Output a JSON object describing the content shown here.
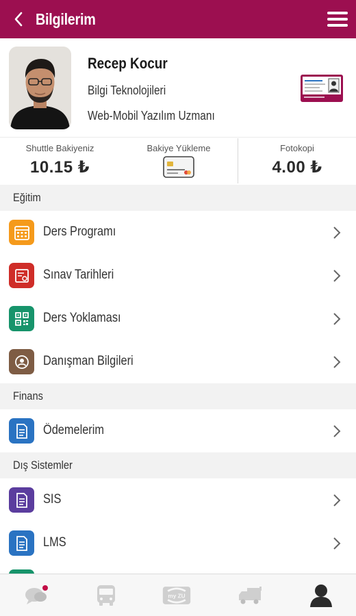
{
  "header": {
    "title": "Bilgilerim",
    "back_icon": "chevron-left-icon",
    "menu_icon": "hamburger-menu-icon",
    "background_color": "#9c0f50"
  },
  "profile": {
    "name": "Recep Kocur",
    "department": "Bilgi Teknolojileri",
    "role": "Web-Mobil Yazılım Uzmanı"
  },
  "balances": {
    "shuttle": {
      "label": "Shuttle Bakiyeniz",
      "value": "10.15 ₺"
    },
    "topup": {
      "label": "Bakiye Yükleme",
      "icon": "credit-card-icon"
    },
    "photocopy": {
      "label": "Fotokopi",
      "value": "4.00 ₺"
    }
  },
  "sections": {
    "education": {
      "title": "Eğitim",
      "items": [
        {
          "label": "Ders Programı",
          "icon": "calendar-icon",
          "color": "#f59a1b"
        },
        {
          "label": "Sınav Tarihleri",
          "icon": "exam-icon",
          "color": "#cf2d28"
        },
        {
          "label": "Ders Yoklaması",
          "icon": "qr-code-icon",
          "color": "#17946b"
        },
        {
          "label": "Danışman Bilgileri",
          "icon": "advisor-icon",
          "color": "#7e5c44"
        }
      ]
    },
    "finance": {
      "title": "Finans",
      "items": [
        {
          "label": "Ödemelerim",
          "icon": "document-icon",
          "color": "#2a73c2"
        }
      ]
    },
    "external": {
      "title": "Dış Sistemler",
      "items": [
        {
          "label": "SIS",
          "icon": "document-icon",
          "color": "#5b3d9e"
        },
        {
          "label": "LMS",
          "icon": "document-icon",
          "color": "#2a73c2"
        }
      ]
    }
  },
  "tabbar": {
    "tabs": [
      {
        "icon": "chat-icon",
        "has_notification": true
      },
      {
        "icon": "bus-icon"
      },
      {
        "icon": "myzu-icon",
        "text": "my ZU"
      },
      {
        "icon": "truck-icon"
      },
      {
        "icon": "user-icon",
        "active": true
      }
    ]
  }
}
